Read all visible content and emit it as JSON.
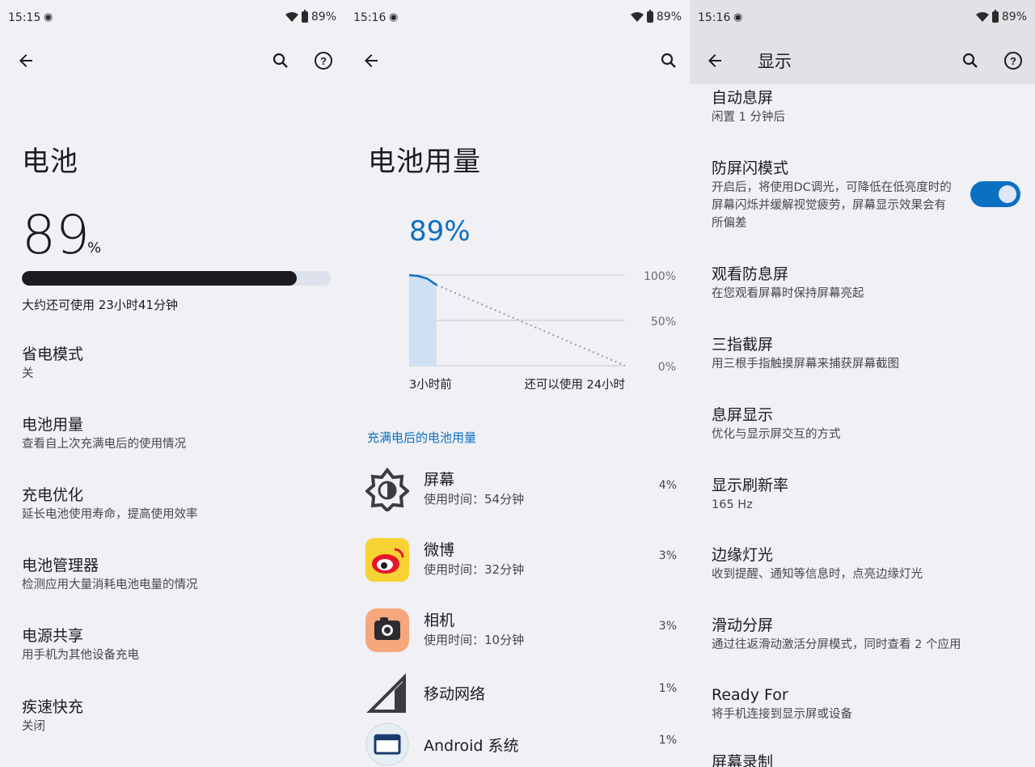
{
  "panel1": {
    "status": {
      "time": "15:15",
      "battery": "89%"
    },
    "title": "电池",
    "battery_percent": "89",
    "battery_unit": "%",
    "battery_level": 0.89,
    "remaining": "大约还可使用 23小时41分钟",
    "items": [
      {
        "title": "省电模式",
        "subtitle": "关"
      },
      {
        "title": "电池用量",
        "subtitle": "查看自上次充满电后的使用情况"
      },
      {
        "title": "充电优化",
        "subtitle": "延长电池使用寿命，提高使用效率"
      },
      {
        "title": "电池管理器",
        "subtitle": "检测应用大量消耗电池电量的情况"
      },
      {
        "title": "电源共享",
        "subtitle": "用手机为其他设备充电"
      },
      {
        "title": "疾速快充",
        "subtitle": "关闭"
      }
    ]
  },
  "panel2": {
    "status": {
      "time": "15:16",
      "battery": "89%"
    },
    "title": "电池用量",
    "percent": "89%",
    "chart_data": {
      "type": "line",
      "y_ticks": [
        "100%",
        "50%",
        "0%"
      ],
      "x_labels": [
        "3小时前",
        "还可以使用 24小时"
      ],
      "ylim": [
        0,
        100
      ],
      "history": [
        100,
        99,
        96,
        89
      ],
      "projection": [
        89,
        0
      ]
    },
    "section": "充满电后的电池用量",
    "apps": [
      {
        "name": "屏幕",
        "usage": "使用时间：54分钟",
        "pct": "4%",
        "icon": "brightness-icon"
      },
      {
        "name": "微博",
        "usage": "使用时间：32分钟",
        "pct": "3%",
        "icon": "weibo-icon"
      },
      {
        "name": "相机",
        "usage": "使用时间：10分钟",
        "pct": "3%",
        "icon": "camera-icon"
      },
      {
        "name": "移动网络",
        "usage": "",
        "pct": "1%",
        "icon": "cell-signal-icon"
      },
      {
        "name": "Android 系统",
        "usage": "",
        "pct": "1%",
        "icon": "android-system-icon"
      }
    ]
  },
  "panel3": {
    "status": {
      "time": "15:16",
      "battery": "89%"
    },
    "title": "显示",
    "toggle_on": true,
    "items": [
      {
        "title": "自动息屏",
        "subtitle": "闲置 1 分钟后"
      },
      {
        "title": "防屏闪模式",
        "subtitle": "开启后，将使用DC调光，可降低在低亮度时的屏幕闪烁并缓解视觉疲劳，屏幕显示效果会有所偏差"
      },
      {
        "title": "观看防息屏",
        "subtitle": "在您观看屏幕时保持屏幕亮起"
      },
      {
        "title": "三指截屏",
        "subtitle": "用三根手指触摸屏幕来捕获屏幕截图"
      },
      {
        "title": "息屏显示",
        "subtitle": "优化与显示屏交互的方式"
      },
      {
        "title": "显示刷新率",
        "subtitle": "165 Hz"
      },
      {
        "title": "边缘灯光",
        "subtitle": "收到提醒、通知等信息时，点亮边缘灯光"
      },
      {
        "title": "滑动分屏",
        "subtitle": "通过往返滑动激活分屏模式，同时查看 2 个应用"
      },
      {
        "title": "Ready For",
        "subtitle": "将手机连接到显示屏或设备"
      },
      {
        "title": "屏幕录制",
        "subtitle": ""
      }
    ]
  },
  "colors": {
    "accent": "#0b6fc2",
    "background": "#f1f0f4",
    "appbar": "#e2e1e6"
  }
}
